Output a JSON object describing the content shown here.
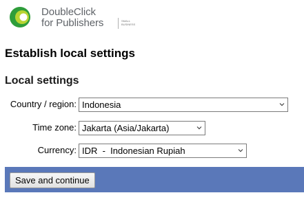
{
  "brand": {
    "name_line1": "DoubleClick",
    "name_line2": "for Publishers",
    "edition_line1": "Small",
    "edition_line2": "Business"
  },
  "page": {
    "title": "Establish local settings",
    "section_title": "Local settings"
  },
  "form": {
    "country": {
      "label": "Country / region:",
      "value": "Indonesia"
    },
    "timezone": {
      "label": "Time zone:",
      "value": "Jakarta (Asia/Jakarta)"
    },
    "currency": {
      "label": "Currency:",
      "value": "IDR  -  Indonesian Rupiah"
    }
  },
  "actions": {
    "save_label": "Save and continue"
  },
  "colors": {
    "footer_bar": "#5a78b9",
    "logo_green_dark": "#2e9d3a",
    "logo_green_light": "#b8d432"
  }
}
